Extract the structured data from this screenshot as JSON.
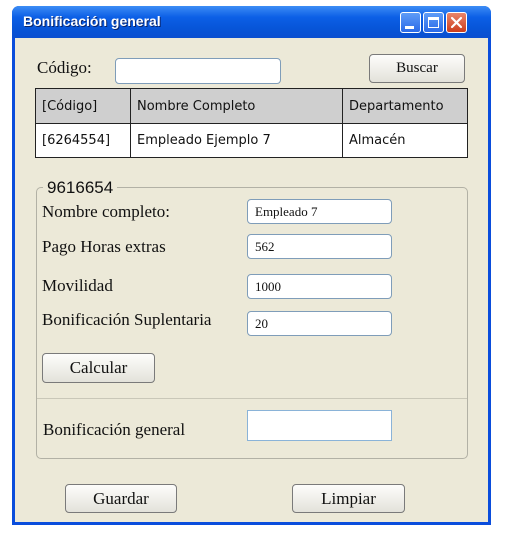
{
  "window": {
    "title": "Bonificación general"
  },
  "search": {
    "label": "Código:",
    "value": "",
    "button": "Buscar"
  },
  "table": {
    "headers": [
      "[Código]",
      "Nombre Completo",
      "Departamento"
    ],
    "rows": [
      [
        "[6264554]",
        "Empleado Ejemplo 7",
        "Almacén"
      ]
    ]
  },
  "group": {
    "title": "9616654",
    "fields": [
      {
        "label": "Nombre completo:",
        "value": "Empleado 7"
      },
      {
        "label": "Pago Horas extras",
        "value": "562"
      },
      {
        "label": "Movilidad",
        "value": "1000"
      },
      {
        "label": "Bonificación Suplentaria",
        "value": "20"
      }
    ],
    "calc_button": "Calcular",
    "result_label": "Bonificación general",
    "result_value": ""
  },
  "footer": {
    "save": "Guardar",
    "clear": "Limpiar"
  },
  "colors": {
    "titlebar": "#0c5fe6",
    "client": "#ece9d8",
    "header_row": "#cfcfcf"
  },
  "icons": [
    "minimize-icon",
    "maximize-icon",
    "close-icon"
  ]
}
